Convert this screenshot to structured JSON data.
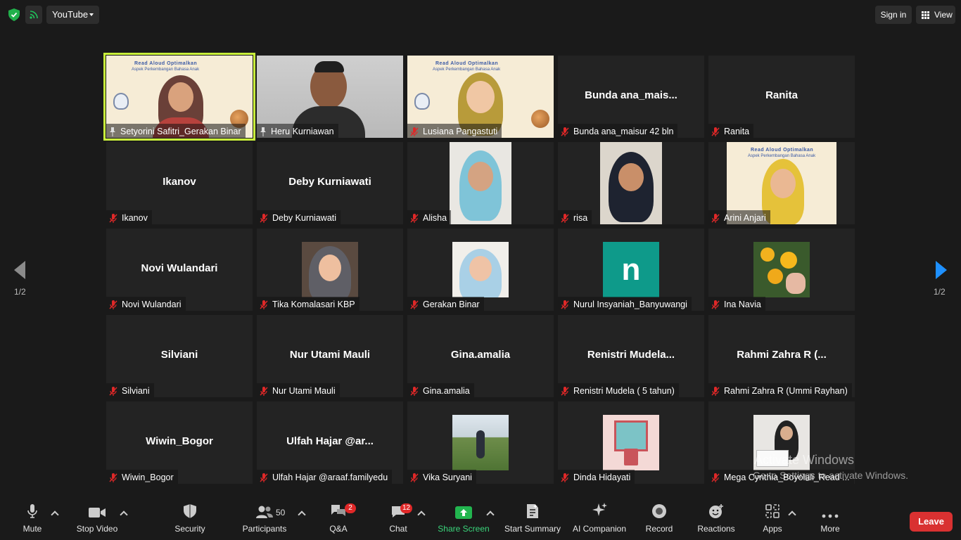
{
  "topbar": {
    "stream_source": "YouTube",
    "sign_in": "Sign in",
    "view": "View"
  },
  "pagination": {
    "left": "1/2",
    "right": "1/2"
  },
  "participants": [
    {
      "name": "Setyorini Safitri_Gerakan Binar",
      "display": "",
      "kind": "banner",
      "active": true,
      "muted": false
    },
    {
      "name": "Heru Kurniawan",
      "display": "",
      "kind": "video",
      "muted": false
    },
    {
      "name": "Lusiana Pangastuti",
      "display": "",
      "kind": "banner-avatar",
      "muted": true
    },
    {
      "name": "Bunda ana_maisur 42 bln",
      "display": "Bunda  ana_mais...",
      "kind": "none",
      "muted": true
    },
    {
      "name": "Ranita",
      "display": "Ranita",
      "kind": "none",
      "muted": true
    },
    {
      "name": "Ikanov",
      "display": "Ikanov",
      "kind": "none",
      "muted": true
    },
    {
      "name": "Deby Kurniawati",
      "display": "Deby Kurniawati",
      "kind": "none",
      "muted": true
    },
    {
      "name": "Alisha",
      "display": "",
      "kind": "video-square",
      "muted": true
    },
    {
      "name": "risa",
      "display": "",
      "kind": "video-square",
      "muted": true
    },
    {
      "name": "Arini Anjari",
      "display": "",
      "kind": "banner-square",
      "muted": true
    },
    {
      "name": "Novi Wulandari",
      "display": "Novi Wulandari",
      "kind": "none",
      "muted": true
    },
    {
      "name": "Tika Komalasari KBP",
      "display": "",
      "kind": "photo",
      "muted": true
    },
    {
      "name": "Gerakan Binar",
      "display": "",
      "kind": "photo",
      "muted": true
    },
    {
      "name": "Nurul Insyaniah_Banyuwangi",
      "display": "",
      "kind": "letter",
      "letter": "n",
      "muted": true
    },
    {
      "name": "Ina Navia",
      "display": "",
      "kind": "photo",
      "muted": true
    },
    {
      "name": "Silviani",
      "display": "Silviani",
      "kind": "none",
      "muted": true
    },
    {
      "name": "Nur Utami Mauli",
      "display": "Nur Utami Mauli",
      "kind": "none",
      "muted": true
    },
    {
      "name": "Gina.amalia",
      "display": "Gina.amalia",
      "kind": "none",
      "muted": true
    },
    {
      "name": "Renistri Mudela ( 5 tahun)",
      "display": "Renistri  Mudela...",
      "kind": "none",
      "muted": true
    },
    {
      "name": "Rahmi Zahra R (Ummi Rayhan)",
      "display": "Rahmi Zahra R (...",
      "kind": "none",
      "muted": true
    },
    {
      "name": "Wiwin_Bogor",
      "display": "Wiwin_Bogor",
      "kind": "none",
      "muted": true
    },
    {
      "name": "Ulfah Hajar @araaf.familyedu",
      "display": "Ulfah  Hajar  @ar...",
      "kind": "none",
      "muted": true
    },
    {
      "name": "Vika Suryani",
      "display": "",
      "kind": "photo",
      "muted": true
    },
    {
      "name": "Dinda Hidayati",
      "display": "",
      "kind": "photo",
      "muted": true
    },
    {
      "name": "Mega Cynthia_Boyolali_Read ...",
      "display": "",
      "kind": "photo",
      "muted": true
    }
  ],
  "banner_text": {
    "line1": "Read Aloud Optimalkan",
    "line2": "Aspek Perkembangan Bahasa Anak"
  },
  "watermark": {
    "line1": "Activate Windows",
    "line2": "Go to Settings to activate Windows."
  },
  "toolbar": {
    "mute": "Mute",
    "stop_video": "Stop Video",
    "security": "Security",
    "participants": "Participants",
    "participants_count": "50",
    "qa": "Q&A",
    "qa_badge": "2",
    "chat": "Chat",
    "chat_badge": "12",
    "share_screen": "Share Screen",
    "start_summary": "Start Summary",
    "ai_companion": "AI Companion",
    "record": "Record",
    "reactions": "Reactions",
    "apps": "Apps",
    "more": "More",
    "leave": "Leave"
  },
  "colors": {
    "active_speaker": "#c9ef3b",
    "share_green": "#22b54f",
    "leave_red": "#d93131",
    "muted_red": "#e02828",
    "next_arrow": "#1e90ff"
  }
}
